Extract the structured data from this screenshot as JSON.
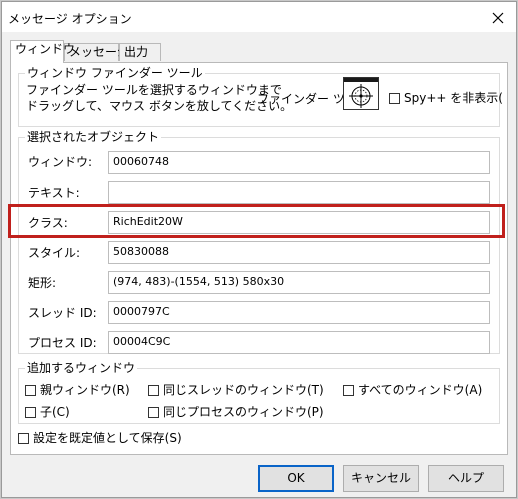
{
  "window": {
    "title": "メッセージ オプション"
  },
  "tabs": [
    {
      "label": "ウィンドウ",
      "active": true
    },
    {
      "label": "メッセージ",
      "active": false
    },
    {
      "label": "出力",
      "active": false
    }
  ],
  "finder": {
    "legend": "ウィンドウ ファインダー ツール",
    "description_line1": "ファインダー ツールを選択するウィンドウまで",
    "description_line2": "ドラッグして、マウス ボタンを放してください。",
    "tool_label": "ファインダー ツール:",
    "tool_icon": "crosshair-target-icon",
    "spy_hide_label": "Spy++ を非表示(",
    "spy_hide_checked": false
  },
  "selected": {
    "legend": "選択されたオブジェクト",
    "fields": [
      {
        "label": "ウィンドウ:",
        "value": "00060748"
      },
      {
        "label": "テキスト:",
        "value": ""
      },
      {
        "label": "クラス:",
        "value": "RichEdit20W"
      },
      {
        "label": "スタイル:",
        "value": "50830088"
      },
      {
        "label": "矩形:",
        "value": "(974, 483)-(1554, 513) 580x30"
      },
      {
        "label": "スレッド ID:",
        "value": "0000797C"
      },
      {
        "label": "プロセス ID:",
        "value": "00004C9C"
      }
    ],
    "highlight_color": "#c0201c"
  },
  "add_windows": {
    "legend": "追加するウィンドウ",
    "options": [
      {
        "label": "親ウィンドウ(R)",
        "checked": false
      },
      {
        "label": "同じスレッドのウィンドウ(T)",
        "checked": false
      },
      {
        "label": "すべてのウィンドウ(A)",
        "checked": false
      },
      {
        "label": "子(C)",
        "checked": false
      },
      {
        "label": "同じプロセスのウィンドウ(P)",
        "checked": false
      }
    ]
  },
  "save_default": {
    "label": "設定を既定値として保存(S)",
    "checked": false
  },
  "buttons": {
    "ok": "OK",
    "cancel": "キャンセル",
    "help": "ヘルプ"
  },
  "colors": {
    "default_button_border": "#0a64c8"
  }
}
